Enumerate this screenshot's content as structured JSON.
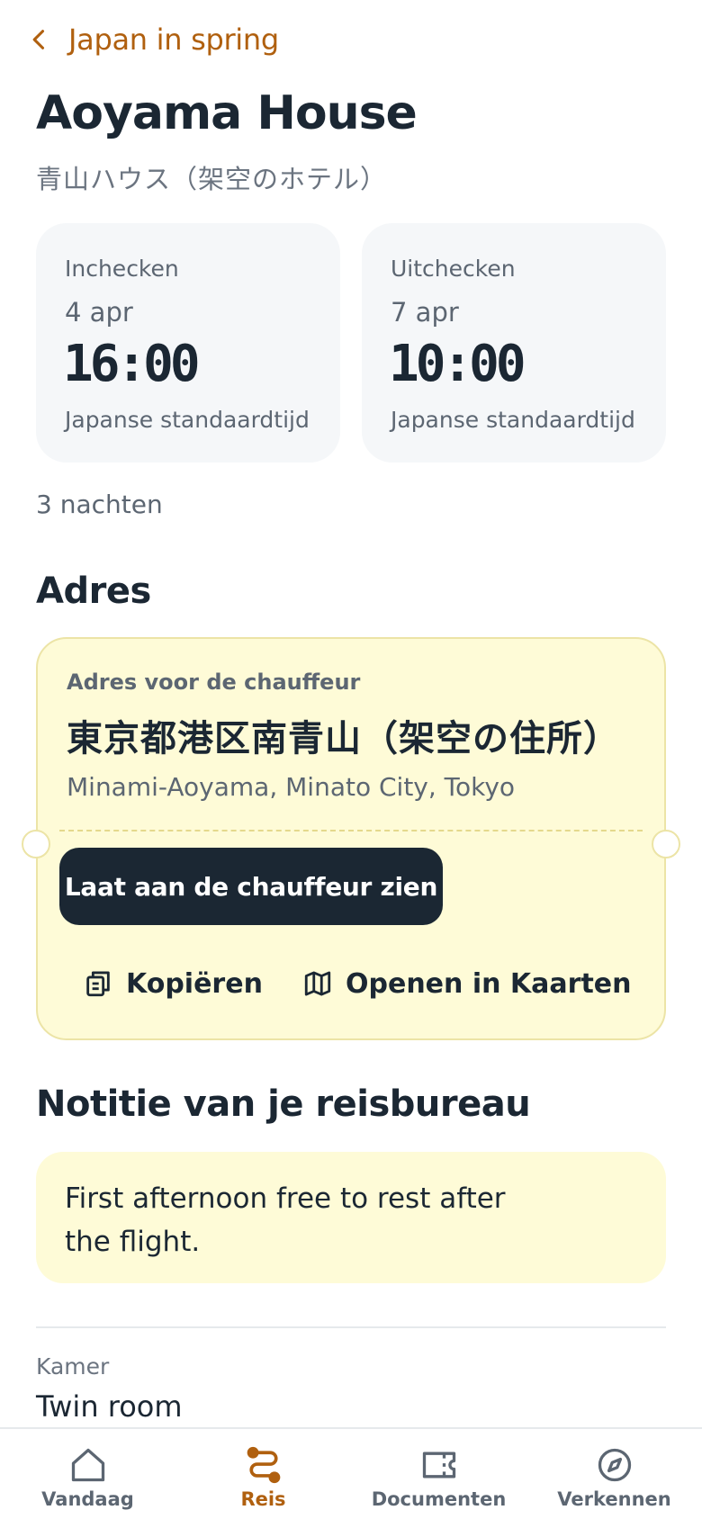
{
  "header": {
    "back_label": "Japan in spring",
    "title": "Aoyama House",
    "subtitle": "青山ハウス（架空のホテル）"
  },
  "checkin": {
    "label": "Inchecken",
    "date": "4 apr",
    "time": "16:00",
    "timezone": "Japanse standaardtijd"
  },
  "checkout": {
    "label": "Uitchecken",
    "date": "7 apr",
    "time": "10:00",
    "timezone": "Japanse standaardtijd"
  },
  "nights": "3 nachten",
  "address": {
    "heading": "Adres",
    "driver_label": "Adres voor de chauffeur",
    "native": "東京都港区南青山（架空の住所）",
    "romanized": "Minami-Aoyama, Minato City, Tokyo",
    "show_driver_button": "Laat aan de chauffeur zien",
    "copy_label": "Kopiëren",
    "maps_label": "Openen in Kaarten"
  },
  "note": {
    "heading": "Notitie van je reisbureau",
    "text": "First afternoon free to rest after the flight."
  },
  "room": {
    "label": "Kamer",
    "value": "Twin room"
  },
  "tabs": [
    {
      "label": "Vandaag",
      "icon": "home-icon"
    },
    {
      "label": "Reis",
      "icon": "route-icon",
      "active": true
    },
    {
      "label": "Documenten",
      "icon": "ticket-icon"
    },
    {
      "label": "Verkennen",
      "icon": "compass-icon"
    }
  ],
  "colors": {
    "accent": "#b0600f",
    "ink": "#1b2733",
    "ticket_bg": "#fefbd7",
    "card_bg": "#f5f7f9"
  }
}
